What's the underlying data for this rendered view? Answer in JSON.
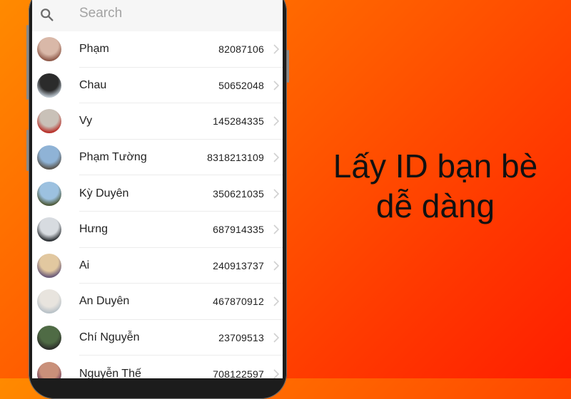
{
  "search": {
    "placeholder": "Search",
    "icon": "search-icon"
  },
  "friends": [
    {
      "name": "Phạm",
      "id": "82087106",
      "avatar_colors": [
        "#d9b8a8",
        "#8f5a4a"
      ]
    },
    {
      "name": "Chau",
      "id": "50652048",
      "avatar_colors": [
        "#2b2b2b",
        "#b9c3cc"
      ]
    },
    {
      "name": "Vy",
      "id": "145284335",
      "avatar_colors": [
        "#c9c1b8",
        "#b8312a"
      ]
    },
    {
      "name": "Phạm Tường",
      "id": "8318213109",
      "avatar_colors": [
        "#8fb3d6",
        "#5a5650"
      ]
    },
    {
      "name": "Kỳ Duyên",
      "id": "350621035",
      "avatar_colors": [
        "#9cc1e0",
        "#4f5b3c"
      ]
    },
    {
      "name": "Hưng",
      "id": "687914335",
      "avatar_colors": [
        "#d7dbe0",
        "#2e3236"
      ]
    },
    {
      "name": "Ai",
      "id": "240913737",
      "avatar_colors": [
        "#e2c8a0",
        "#6a5a78"
      ]
    },
    {
      "name": "An Duyên",
      "id": "467870912",
      "avatar_colors": [
        "#e8e4de",
        "#b9c2c8"
      ]
    },
    {
      "name": "Chí Nguyễn",
      "id": "23709513",
      "avatar_colors": [
        "#4f6b45",
        "#2d2f2a"
      ]
    },
    {
      "name": "Nguyễn Thế",
      "id": "708122597",
      "avatar_colors": [
        "#c9907a",
        "#6b3a5a"
      ]
    }
  ],
  "headline": {
    "line1": "Lấy ID bạn bè",
    "line2": "dễ dàng"
  },
  "colors": {
    "background_start": "#ff8a00",
    "background_end": "#ff1e00",
    "text": "#111111"
  }
}
